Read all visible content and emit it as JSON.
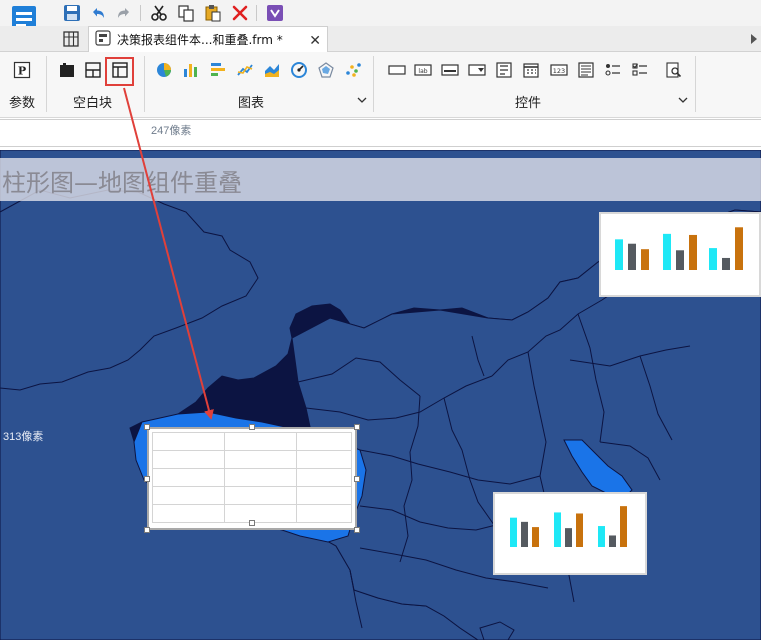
{
  "tab": {
    "title": "决策报表组件本...和重叠.frm *",
    "close": "✕"
  },
  "ribbon": {
    "groups": [
      {
        "label": "参数"
      },
      {
        "label": "空白块"
      },
      {
        "label": "图表"
      },
      {
        "label": "控件"
      }
    ],
    "param_icon_letter": "P",
    "control_icon_text": "lab",
    "control_number_text": "123"
  },
  "ruler": {
    "width_label": "247像素"
  },
  "canvas": {
    "title": "柱形图—地图组件重叠",
    "height_label": "313像素"
  },
  "colors": {
    "canvas_bg": "#0c1442",
    "map_fill": "#2d5190",
    "highlight_region": "#1a74e8",
    "bar_cyan": "#1ee8f6",
    "bar_gray": "#555a60",
    "bar_orange": "#c8720d",
    "highlight_box": "#e0403a"
  },
  "icons": {
    "logo": "report-designer-logo-icon",
    "save": "save-icon",
    "undo": "undo-icon",
    "redo": "redo-icon",
    "cut": "cut-icon",
    "copy": "copy-icon",
    "paste": "paste-icon",
    "delete": "delete-icon",
    "template": "template-icon"
  },
  "chart_data": [
    {
      "type": "bar",
      "categories": [
        "",
        "",
        ""
      ],
      "series": [
        {
          "values": [
            28,
            33,
            20
          ]
        },
        {
          "values": [
            24,
            18,
            11
          ]
        },
        {
          "values": [
            19,
            32,
            39
          ]
        }
      ],
      "ylim": [
        0,
        42
      ],
      "grid": false,
      "legend": "none"
    },
    {
      "type": "bar",
      "categories": [
        "",
        "",
        ""
      ],
      "series": [
        {
          "values": [
            28,
            33,
            20
          ]
        },
        {
          "values": [
            24,
            18,
            11
          ]
        },
        {
          "values": [
            19,
            32,
            39
          ]
        }
      ],
      "ylim": [
        0,
        42
      ],
      "grid": false,
      "legend": "none"
    }
  ]
}
